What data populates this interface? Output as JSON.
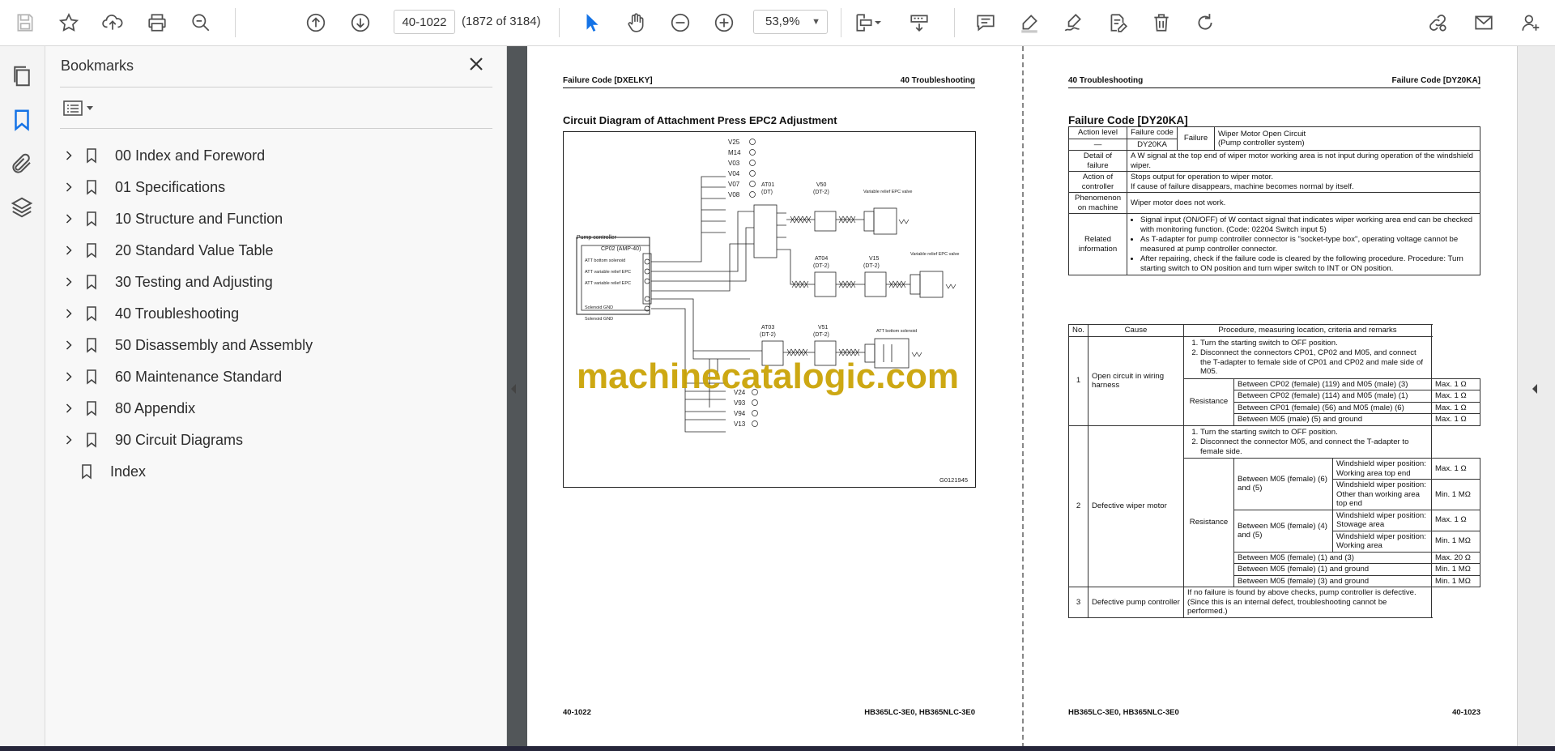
{
  "toolbar": {
    "page_input": "40-1022",
    "page_count": "(1872 of 3184)",
    "zoom": "53,9%"
  },
  "bookmarks_panel": {
    "title": "Bookmarks",
    "items": [
      {
        "label": "00 Index and Foreword",
        "expandable": true
      },
      {
        "label": "01 Specifications",
        "expandable": true
      },
      {
        "label": "10 Structure and Function",
        "expandable": true
      },
      {
        "label": "20 Standard Value Table",
        "expandable": true
      },
      {
        "label": "30 Testing and Adjusting",
        "expandable": true
      },
      {
        "label": "40 Troubleshooting",
        "expandable": true
      },
      {
        "label": "50 Disassembly and Assembly",
        "expandable": true
      },
      {
        "label": "60 Maintenance Standard",
        "expandable": true
      },
      {
        "label": "80 Appendix",
        "expandable": true
      },
      {
        "label": "90 Circuit Diagrams",
        "expandable": true
      },
      {
        "label": "Index",
        "expandable": false
      }
    ]
  },
  "left_page": {
    "header_left": "Failure Code [DXELKY]",
    "header_right": "40 Troubleshooting",
    "section_title": "Circuit Diagram of Attachment Press EPC2 Adjustment",
    "figure_id": "G0121945",
    "footer_left": "40-1022",
    "footer_right": "HB365LC-3E0, HB365NLC-3E0",
    "diagram": {
      "connector_labels": [
        "V25",
        "M14",
        "V03",
        "V04",
        "V07",
        "V08"
      ],
      "lower_labels": [
        "V24",
        "V93",
        "V94",
        "V13"
      ],
      "controller_title": "Pump controller",
      "controller_connector": "CP02 (AMP-40)",
      "controller_rows": [
        "ATT bottom solenoid",
        "ATT variable relief EPC",
        "ATT variable relief EPC",
        "Solenoid GND",
        "Solenoid GND"
      ],
      "blocks": [
        "AT01",
        "(DT)",
        "V50",
        "(DT-2)",
        "AT04",
        "(DT-2)",
        "V15",
        "(DT-2)",
        "AT03",
        "(DT-2)",
        "V51",
        "(DT-2)"
      ],
      "valve_labels": [
        "Variable relief EPC valve",
        "Variable relief EPC valve",
        "ATT bottom solenoid"
      ]
    }
  },
  "watermark": "machinecatalogic.com",
  "right_page": {
    "header_left": "40 Troubleshooting",
    "header_right": "Failure Code [DY20KA]",
    "title": "Failure Code [DY20KA]",
    "footer_left": "HB365LC-3E0, HB365NLC-3E0",
    "footer_right": "40-1023",
    "info": {
      "action_level_label": "Action level",
      "failure_code_label": "Failure code",
      "failure_label": "Failure",
      "failure_name": "Wiper Motor Open Circuit",
      "failure_sub": "(Pump controller system)",
      "action_level_value": "—",
      "failure_code_value": "DY20KA",
      "detail_label": "Detail of failure",
      "detail_text": "A W signal at the top end of wiper motor working area is not input during operation of the windshield wiper.",
      "action_label": "Action of controller",
      "action_lines": [
        "Stops output for operation to wiper motor.",
        "If cause of failure disappears, machine becomes normal by itself."
      ],
      "phenomenon_label": "Phenomenon on machine",
      "phenomenon_text": "Wiper motor does not work.",
      "related_label": "Related information",
      "related_items": [
        "Signal input (ON/OFF) of W contact signal that indicates wiper working area end can be checked with monitoring function. (Code: 02204 Switch input 5)",
        "As T-adapter for pump controller connector is \"socket-type box\", operating voltage cannot be measured at pump controller connector.",
        "After repairing, check if the failure code is cleared by the following procedure. Procedure: Turn starting switch to ON position and turn wiper switch to INT or ON position."
      ]
    },
    "causes": {
      "head_no": "No.",
      "head_cause": "Cause",
      "head_proc": "Procedure, measuring location, criteria and remarks",
      "c1_no": "1",
      "c1_name": "Open circuit in wiring harness",
      "c1_steps": [
        "Turn the starting switch to OFF position.",
        "Disconnect the connectors CP01, CP02 and M05, and connect the T-adapter to female side of CP01 and CP02 and male side of M05."
      ],
      "resistance": "Resistance",
      "c1_rows": [
        {
          "loc": "Between CP02 (female) (119) and M05 (male) (3)",
          "val": "Max. 1 Ω"
        },
        {
          "loc": "Between CP02 (female) (114) and M05 (male) (1)",
          "val": "Max. 1 Ω"
        },
        {
          "loc": "Between CP01 (female) (56) and M05 (male) (6)",
          "val": "Max. 1 Ω"
        },
        {
          "loc": "Between M05 (male) (5) and ground",
          "val": "Max. 1 Ω"
        }
      ],
      "c2_no": "2",
      "c2_name": "Defective wiper motor",
      "c2_steps": [
        "Turn the starting switch to OFF position.",
        "Disconnect the connector M05, and connect the T-adapter to female side."
      ],
      "c2_loc_a": "Between M05 (female) (6) and (5)",
      "c2_loc_b": "Between M05 (female) (4) and (5)",
      "c2_sub": [
        {
          "cond": "Windshield wiper position: Working area top end",
          "val": "Max. 1 Ω"
        },
        {
          "cond": "Windshield wiper position: Other than working area top end",
          "val": "Min. 1 MΩ"
        },
        {
          "cond": "Windshield wiper position: Stowage area",
          "val": "Max. 1 Ω"
        },
        {
          "cond": "Windshield wiper position: Working area",
          "val": "Min. 1 MΩ"
        }
      ],
      "c2_rows": [
        {
          "loc": "Between M05 (female) (1) and (3)",
          "val": "Max. 20 Ω"
        },
        {
          "loc": "Between M05 (female) (1) and ground",
          "val": "Min. 1 MΩ"
        },
        {
          "loc": "Between M05 (female) (3) and ground",
          "val": "Min. 1 MΩ"
        }
      ],
      "c3_no": "3",
      "c3_name": "Defective pump controller",
      "c3_text": "If no failure is found by above checks, pump controller is defective. (Since this is an internal defect, troubleshooting cannot be performed.)"
    }
  },
  "icons": {
    "toolbar_left": [
      "save-icon",
      "star-icon",
      "upload-icon",
      "print-icon",
      "zoom-search-icon",
      "page-up-icon",
      "page-down-icon"
    ],
    "toolbar_mid": [
      "select-arrow-icon",
      "hand-icon",
      "zoom-out-icon",
      "zoom-in-icon",
      "fit-page-icon",
      "scroll-mode-icon"
    ],
    "toolbar_right": [
      "comment-icon",
      "highlight-icon",
      "sign-icon",
      "edit-pdf-icon",
      "delete-icon",
      "rotate-icon",
      "share-link-icon",
      "email-icon",
      "add-user-icon"
    ]
  }
}
